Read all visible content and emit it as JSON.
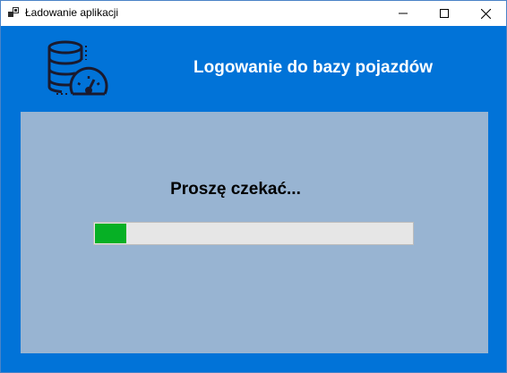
{
  "window": {
    "title": "Ładowanie aplikacji",
    "icon": "app-window-icon",
    "controls": [
      "minimize-icon",
      "maximize-icon",
      "close-icon"
    ]
  },
  "header": {
    "title": "Logowanie do bazy pojazdów",
    "icon": "database-speedometer-icon"
  },
  "status": {
    "message": "Proszę czekać..."
  },
  "progress": {
    "value_percent": 10
  },
  "colors": {
    "background": "#0173d8",
    "panel": "#98b4d2",
    "progress_track": "#e6e6e6",
    "progress_fill": "#06b025",
    "header_text": "#ffffff"
  }
}
